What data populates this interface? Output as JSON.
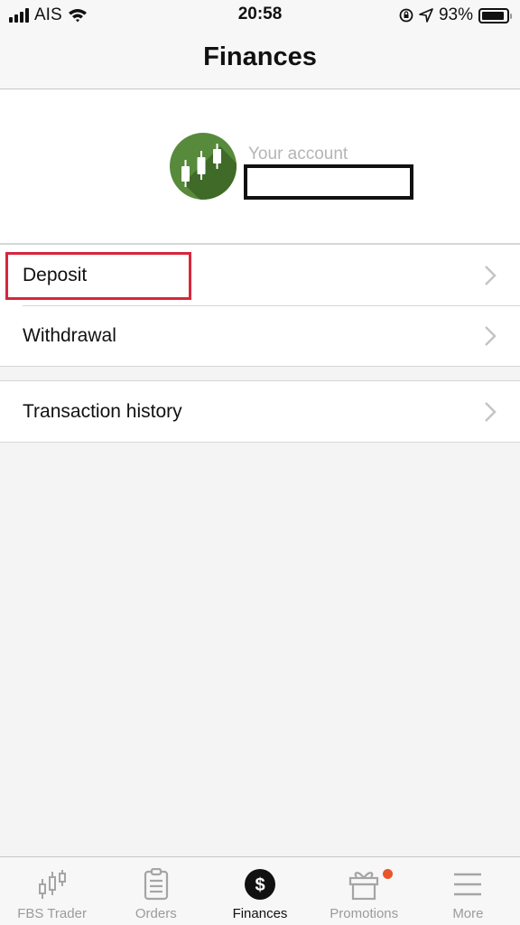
{
  "status_bar": {
    "carrier": "AIS",
    "time": "20:58",
    "battery_percent": "93%",
    "battery_level": 0.93
  },
  "header": {
    "title": "Finances"
  },
  "account": {
    "label": "Your account",
    "value": ""
  },
  "menu_groups": [
    {
      "items": [
        {
          "label": "Deposit",
          "highlighted": true
        },
        {
          "label": "Withdrawal",
          "highlighted": false
        }
      ]
    },
    {
      "items": [
        {
          "label": "Transaction history",
          "highlighted": false
        }
      ]
    }
  ],
  "tab_bar": {
    "tabs": [
      {
        "label": "FBS Trader",
        "icon": "candlestick-icon",
        "active": false
      },
      {
        "label": "Orders",
        "icon": "clipboard-icon",
        "active": false
      },
      {
        "label": "Finances",
        "icon": "dollar-icon",
        "active": true
      },
      {
        "label": "Promotions",
        "icon": "gift-icon",
        "active": false,
        "badge": true
      },
      {
        "label": "More",
        "icon": "menu-icon",
        "active": false
      }
    ]
  },
  "colors": {
    "accent_green": "#578a3b",
    "highlight_red": "#d7263d",
    "badge_orange": "#e8562a"
  }
}
